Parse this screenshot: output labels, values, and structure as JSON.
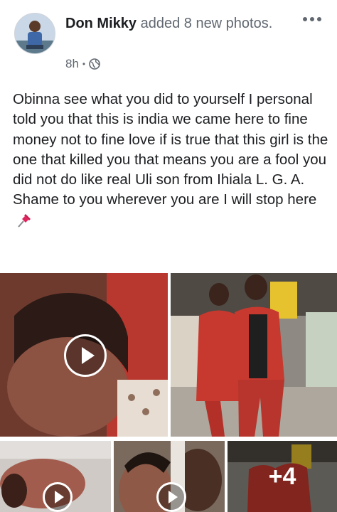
{
  "post": {
    "author": "Don Mikky",
    "action": " added 8 new photos.",
    "time": "8h",
    "separator": "•",
    "privacy_icon": "globe-icon",
    "more_icon": "more-dots-icon",
    "text": "Obinna see what you did to yourself I personal told you that this is india we came here to fine money not to fine love if is true that this girl is the one that killed you that means you are a fool you did not do like real Uli son from Ihiala L. G. A. Shame to you wherever you are I will stop here",
    "emoji_icon": "pushpin-icon"
  },
  "gallery": {
    "extra_count": "+4"
  },
  "colors": {
    "secondary_text": "#606770",
    "primary_text": "#1c1e21",
    "pushpin": "#e0245e"
  }
}
